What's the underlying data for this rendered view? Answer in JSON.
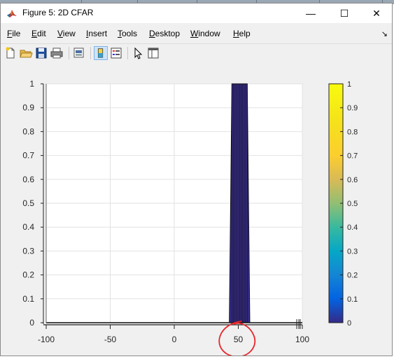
{
  "window": {
    "title": "Figure 5: 2D CFAR",
    "minimize_glyph": "—",
    "maximize_glyph": "☐",
    "close_glyph": "✕"
  },
  "menu": {
    "items": [
      {
        "label": "File",
        "underline": "F",
        "rest": "ile"
      },
      {
        "label": "Edit",
        "underline": "E",
        "rest": "dit"
      },
      {
        "label": "View",
        "underline": "V",
        "rest": "iew"
      },
      {
        "label": "Insert",
        "underline": "I",
        "rest": "nsert"
      },
      {
        "label": "Tools",
        "underline": "T",
        "rest": "ools"
      },
      {
        "label": "Desktop",
        "underline": "D",
        "rest": "esktop"
      },
      {
        "label": "Window",
        "underline": "W",
        "rest": "indow"
      },
      {
        "label": "Help",
        "underline": "H",
        "rest": "elp"
      }
    ],
    "dock_arrow": "↘"
  },
  "toolbar": {
    "buttons": [
      "new-figure-icon",
      "open-file-icon",
      "save-icon",
      "print-icon",
      "print-preview-icon",
      "insert-colorbar-icon",
      "insert-legend-icon",
      "pointer-icon",
      "property-editor-icon"
    ],
    "active": [
      "insert-colorbar-icon"
    ]
  },
  "chart_data": {
    "type": "area",
    "title": "",
    "xlabel": "",
    "ylabel": "",
    "xlim": [
      -100,
      100
    ],
    "ylim": [
      0,
      1
    ],
    "xticks": [
      "-100",
      "-50",
      "0",
      "50",
      "100"
    ],
    "yticks": [
      "0",
      "0.1",
      "0.2",
      "0.3",
      "0.4",
      "0.5",
      "0.6",
      "0.7",
      "0.8",
      "0.9",
      "1"
    ],
    "grid": true,
    "series": [
      {
        "x": [
          -100,
          43,
          45,
          57,
          59,
          100
        ],
        "values": [
          0,
          0,
          1,
          1,
          0,
          0
        ]
      }
    ],
    "fill_color": "#352a87",
    "colorbar": {
      "ticks": [
        "0",
        "0.1",
        "0.2",
        "0.3",
        "0.4",
        "0.5",
        "0.6",
        "0.7",
        "0.8",
        "0.9",
        "1"
      ],
      "colormap": "parula",
      "range": [
        0,
        1
      ]
    },
    "annotation": {
      "type": "hand-drawn circle",
      "color": "#e8262b",
      "around": "50"
    }
  }
}
